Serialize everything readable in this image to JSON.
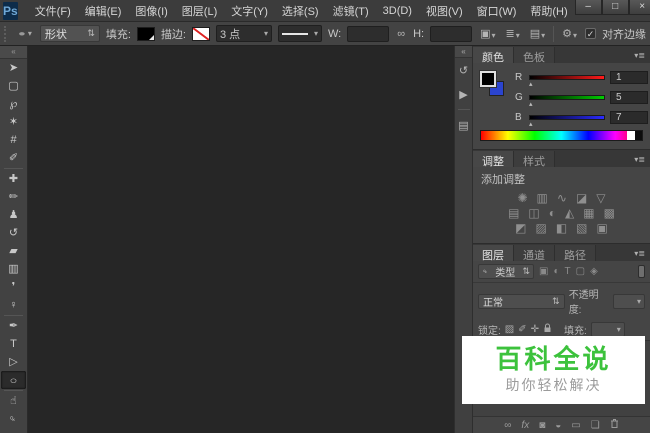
{
  "window": {
    "logo": "Ps",
    "controls": [
      {
        "name": "minimize",
        "glyph": "–"
      },
      {
        "name": "maximize",
        "glyph": "□"
      },
      {
        "name": "close",
        "glyph": "×"
      }
    ]
  },
  "menu": {
    "items": [
      "文件(F)",
      "编辑(E)",
      "图像(I)",
      "图层(L)",
      "文字(Y)",
      "选择(S)",
      "滤镜(T)",
      "3D(D)",
      "视图(V)",
      "窗口(W)",
      "帮助(H)"
    ]
  },
  "options": {
    "tool_preset_glyph": "●",
    "caret": "▾",
    "spin": "⇅",
    "shape_mode": "形状",
    "fill_label": "填充:",
    "fill_color": "#000000",
    "stroke_label": "描边:",
    "stroke_width": "3 点",
    "w_label": "W:",
    "w_value": "",
    "h_label": "H:",
    "h_value": "",
    "link_glyph": "∞",
    "path_ops_glyph": "▣",
    "align_glyph": "≣",
    "arrange_glyph": "▤",
    "gear_glyph": "⚙",
    "check_glyph": "✓",
    "align_edges": "对齐边缘"
  },
  "toolbar": {
    "collapse_glyph": "«",
    "tools": [
      {
        "name": "move-tool",
        "glyph": "➤"
      },
      {
        "name": "rectangular-marquee-tool",
        "glyph": "▢"
      },
      {
        "name": "lasso-tool",
        "glyph": "℘"
      },
      {
        "name": "magic-wand-tool",
        "glyph": "✶"
      },
      {
        "name": "crop-tool",
        "glyph": "#"
      },
      {
        "name": "eyedropper-tool",
        "glyph": "✐"
      },
      {
        "name": "spot-healing-brush-tool",
        "glyph": "✚"
      },
      {
        "name": "brush-tool",
        "glyph": "✏"
      },
      {
        "name": "clone-stamp-tool",
        "glyph": "♟"
      },
      {
        "name": "history-brush-tool",
        "glyph": "↺"
      },
      {
        "name": "eraser-tool",
        "glyph": "▰"
      },
      {
        "name": "gradient-tool",
        "glyph": "▥"
      },
      {
        "name": "blur-tool",
        "glyph": "❜"
      },
      {
        "name": "dodge-tool",
        "glyph": "♀"
      },
      {
        "name": "pen-tool",
        "glyph": "✒"
      },
      {
        "name": "type-tool",
        "glyph": "T"
      },
      {
        "name": "path-selection-tool",
        "glyph": "▷"
      },
      {
        "name": "ellipse-tool",
        "glyph": "○"
      },
      {
        "name": "hand-tool",
        "glyph": "☝"
      },
      {
        "name": "zoom-tool",
        "glyph": "♀"
      }
    ],
    "selected_tool": "ellipse-tool"
  },
  "dock": {
    "collapse_glyph": "«",
    "icons": [
      {
        "name": "history-panel",
        "glyph": "↺"
      },
      {
        "name": "actions-panel",
        "glyph": "▶"
      },
      {
        "name": "properties-panel",
        "glyph": "▤"
      }
    ]
  },
  "panels": {
    "collapse_glyph": "»",
    "menu_glyph": "▾≣",
    "color": {
      "tabs": [
        "颜色",
        "色板"
      ],
      "foreground": "#000000",
      "background": "#2b44cf",
      "channels": [
        {
          "label": "R",
          "value": "1",
          "color": "#ff1a1a"
        },
        {
          "label": "G",
          "value": "5",
          "color": "#00cc00"
        },
        {
          "label": "B",
          "value": "7",
          "color": "#2a2aff"
        }
      ]
    },
    "adjustments": {
      "tabs": [
        "调整",
        "样式"
      ],
      "hint": "添加调整",
      "icons": [
        {
          "name": "brightness-contrast",
          "glyph": "✺"
        },
        {
          "name": "levels",
          "glyph": "▥"
        },
        {
          "name": "curves",
          "glyph": "∿"
        },
        {
          "name": "exposure",
          "glyph": "◪"
        },
        {
          "name": "vibrance",
          "glyph": "▽"
        },
        {
          "name": "hue-saturation",
          "glyph": "▤"
        },
        {
          "name": "color-balance",
          "glyph": "◫"
        },
        {
          "name": "black-white",
          "glyph": "◐"
        },
        {
          "name": "photo-filter",
          "glyph": "◭"
        },
        {
          "name": "channel-mixer",
          "glyph": "▦"
        },
        {
          "name": "color-lookup",
          "glyph": "▩"
        },
        {
          "name": "invert",
          "glyph": "◩"
        },
        {
          "name": "posterize",
          "glyph": "▨"
        },
        {
          "name": "threshold",
          "glyph": "◧"
        },
        {
          "name": "gradient-map",
          "glyph": "▧"
        },
        {
          "name": "selective-color",
          "glyph": "▣"
        }
      ]
    },
    "layers": {
      "tabs": [
        "图层",
        "通道",
        "路径"
      ],
      "search_glyph": "♀",
      "filter_label": "类型",
      "filter_icons": [
        {
          "name": "pixel-layer-filter",
          "glyph": "▣"
        },
        {
          "name": "adjustment-layer-filter",
          "glyph": "◐"
        },
        {
          "name": "type-layer-filter",
          "glyph": "T"
        },
        {
          "name": "shape-layer-filter",
          "glyph": "▢"
        },
        {
          "name": "smart-object-filter",
          "glyph": "◈"
        }
      ],
      "blend_mode": "正常",
      "opacity_label": "不透明度:",
      "lock_label": "锁定:",
      "lock_icons": [
        {
          "name": "lock-transparent-pixels",
          "glyph": "▨"
        },
        {
          "name": "lock-image-pixels",
          "glyph": "✐"
        },
        {
          "name": "lock-position",
          "glyph": "✛"
        }
      ],
      "fill_label": "填充:",
      "buttons": {
        "link_glyph": "∞",
        "fx_label": "fx",
        "mask_glyph": "◙",
        "adjustment_glyph": "◒",
        "group_glyph": "▭",
        "new_layer_glyph": "❏"
      }
    }
  },
  "watermark": {
    "title": "百科全说",
    "subtitle": "助你轻松解决",
    "title_color": "#3cc23c",
    "bg": "#ffffff"
  },
  "colors": {
    "canvas": "#262626",
    "menubar": "#3c3c3c",
    "panel": "#454545"
  }
}
